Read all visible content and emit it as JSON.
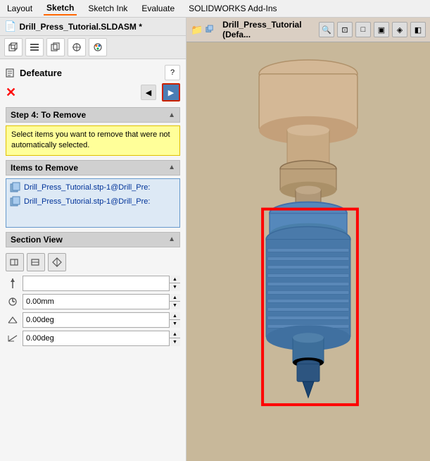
{
  "menu": {
    "items": [
      "Layout",
      "Sketch",
      "Sketch Ink",
      "Evaluate",
      "SOLIDWORKS Add-Ins"
    ],
    "active": "Sketch"
  },
  "file_title": "Drill_Press_Tutorial.SLDASM *",
  "toolbar": {
    "buttons": [
      "cube",
      "list",
      "copy",
      "crosshair",
      "palette"
    ]
  },
  "panel": {
    "title": "Defeature",
    "help_label": "?",
    "back_label": "◀",
    "forward_label": "▶",
    "close_label": "✕"
  },
  "step4": {
    "header": "Step 4: To Remove",
    "warning": "Select items you want to remove that were not automatically selected."
  },
  "items_to_remove": {
    "header": "Items to Remove",
    "items": [
      "Drill_Press_Tutorial.stp-1@Drill_Pre:",
      "Drill_Press_Tutorial.stp-1@Drill_Pre:"
    ]
  },
  "section_view": {
    "header": "Section View",
    "buttons": [
      "plane-icon",
      "plane2-icon",
      "plane3-icon"
    ],
    "distance_label": "0.00mm",
    "angle1_label": "0.00deg",
    "angle2_label": "0.00deg",
    "distance_placeholder": "",
    "distance_value": "0.00mm",
    "angle1_value": "0.00deg",
    "angle2_value": "0.00deg"
  },
  "right_panel": {
    "model_name": "Drill_Press_Tutorial (Defa...",
    "toolbar_icons": [
      "zoom",
      "fit",
      "view1",
      "view2",
      "view3",
      "view4"
    ]
  }
}
